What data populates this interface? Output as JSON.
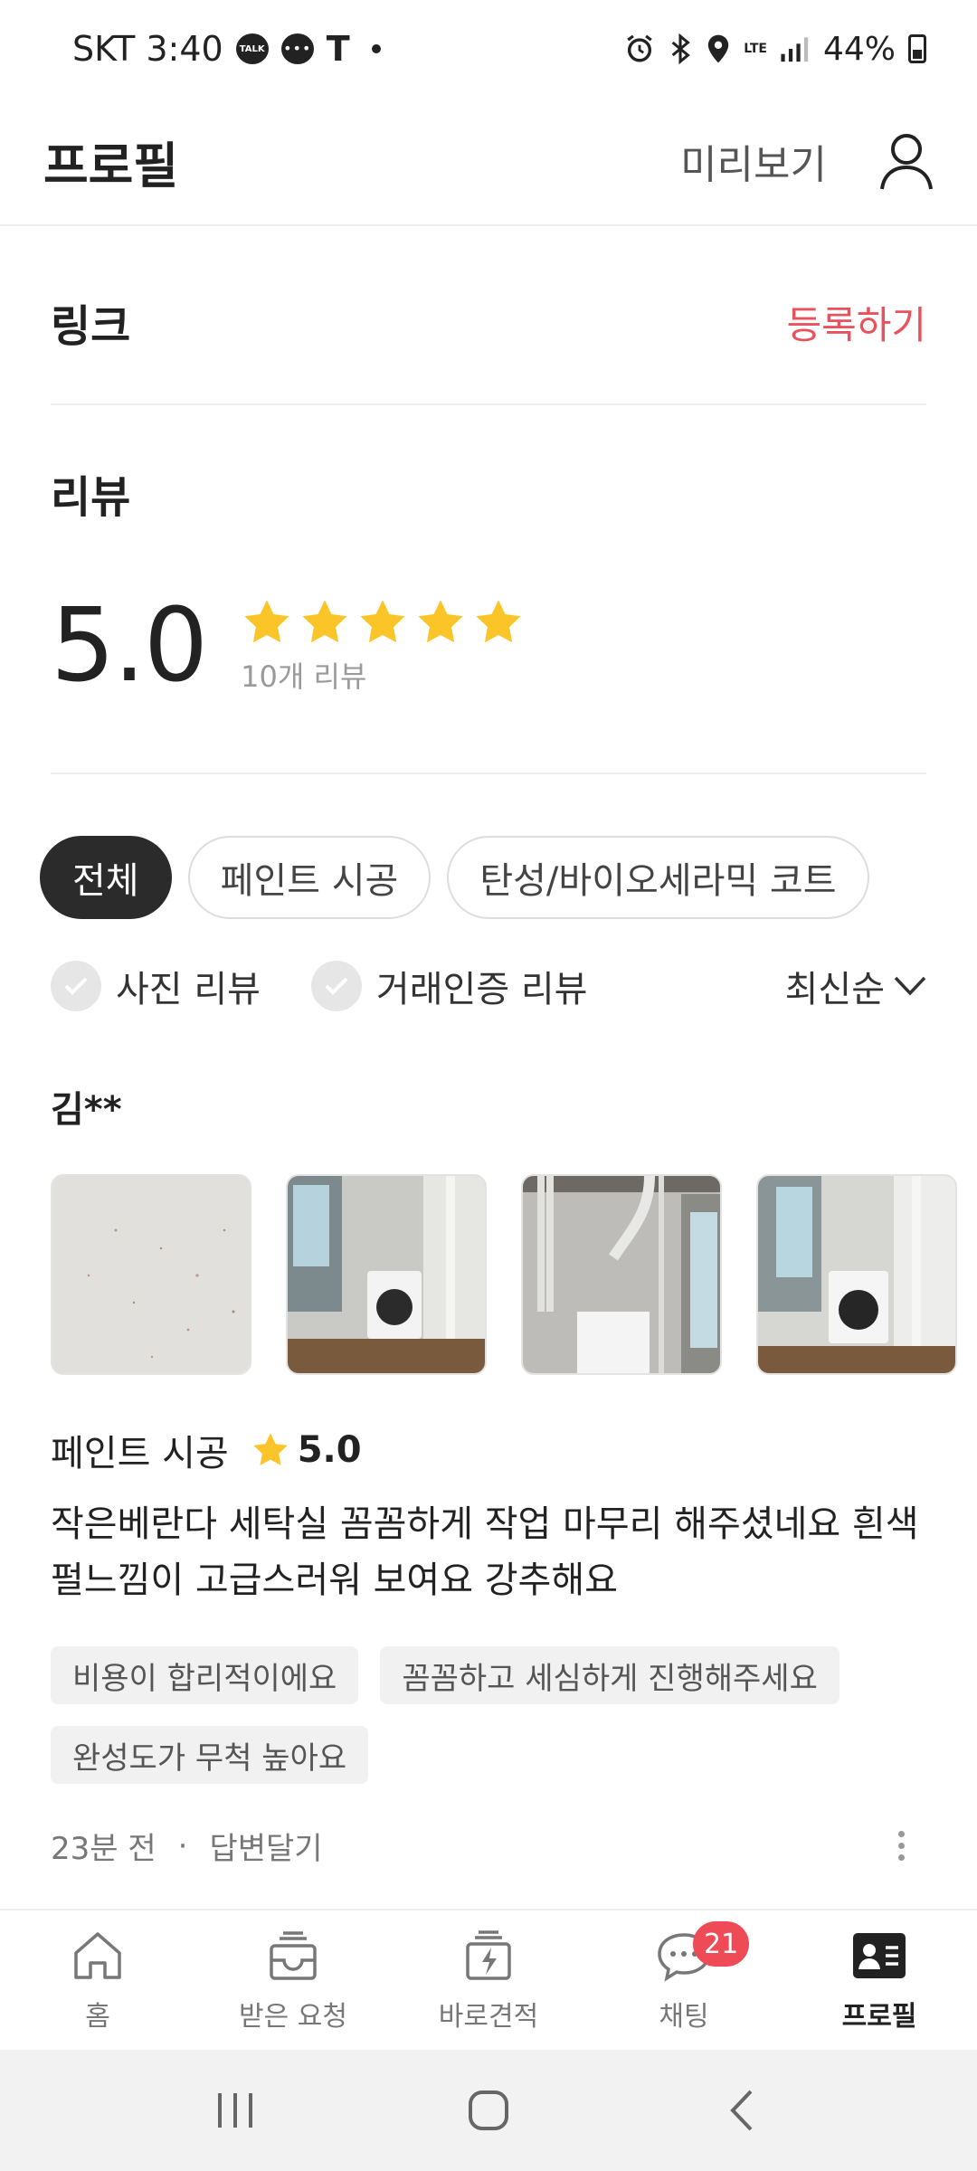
{
  "status_bar": {
    "carrier_time": "SKT 3:40",
    "talk_label": "TALK",
    "t_label": "T",
    "lte_label": "LTE",
    "battery": "44%"
  },
  "header": {
    "title": "프로필",
    "preview_label": "미리보기"
  },
  "link_section": {
    "title": "링크",
    "register_label": "등록하기"
  },
  "review_section": {
    "title": "리뷰",
    "rating": "5.0",
    "stars": 5,
    "count_label": "10개 리뷰"
  },
  "category_chips": [
    {
      "label": "전체",
      "active": true
    },
    {
      "label": "페인트 시공",
      "active": false
    },
    {
      "label": "탄성/바이오세라믹 코트",
      "active": false
    }
  ],
  "filters": {
    "photo_review": "사진 리뷰",
    "verified_review": "거래인증 리뷰",
    "sort_label": "최신순"
  },
  "review": {
    "reviewer": "김**",
    "category": "페인트 시공",
    "score": "5.0",
    "text_line1": "작은베란다 세탁실  꼼꼼하게 작업 마무리 해주셨네요 흰색",
    "text_line2": "펄느낌이 고급스러워 보여요 강추해요",
    "tags": [
      "비용이 합리적이에요",
      "꼼꼼하고 세심하게 진행해주세요",
      "완성도가 무척 높아요"
    ],
    "time_ago": "23분 전",
    "separator": "·",
    "reply_label": "답변달기"
  },
  "bottom_nav": {
    "items": [
      {
        "label": "홈",
        "icon": "home-icon"
      },
      {
        "label": "받은 요청",
        "icon": "inbox-icon"
      },
      {
        "label": "바로견적",
        "icon": "quick-quote-icon"
      },
      {
        "label": "채팅",
        "icon": "chat-icon"
      },
      {
        "label": "프로필",
        "icon": "profile-card-icon"
      }
    ],
    "chat_badge": "21",
    "active_index": 4
  },
  "colors": {
    "accent_red": "#e9525c",
    "star_yellow": "#fbc52a",
    "badge_red": "#ee4b57",
    "chip_active": "#2b2b2b"
  }
}
